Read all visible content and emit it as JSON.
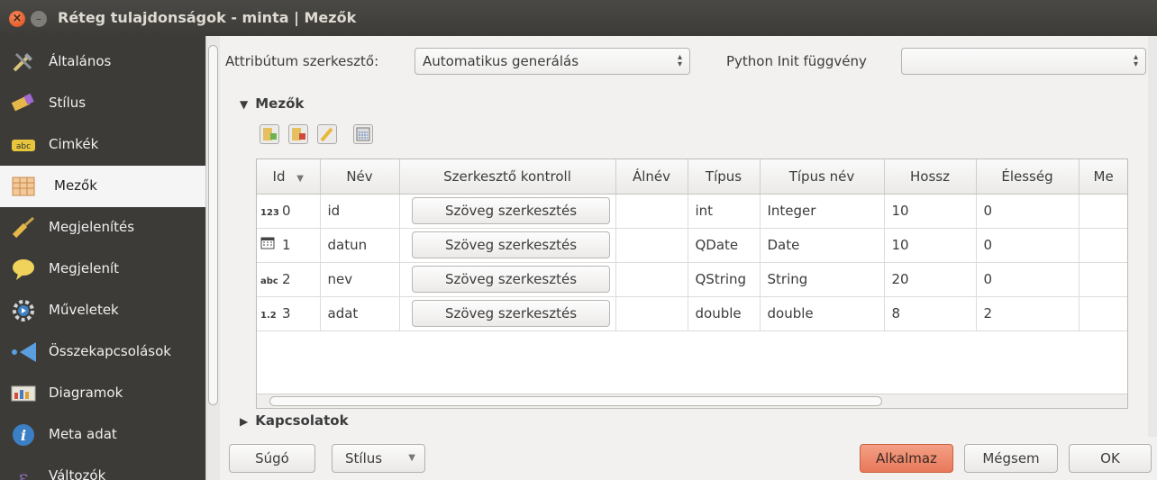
{
  "window": {
    "title": "Réteg tulajdonságok - minta | Mezők"
  },
  "sidebar": {
    "items": [
      {
        "label": "Általános",
        "icon": "tools-icon"
      },
      {
        "label": "Stílus",
        "icon": "brush-icon"
      },
      {
        "label": "Cimkék",
        "icon": "label-abc-icon"
      },
      {
        "label": "Mezők",
        "icon": "table-icon"
      },
      {
        "label": "Megjelenítés",
        "icon": "paint-brush-icon"
      },
      {
        "label": "Megjelenít",
        "icon": "speech-bubble-icon"
      },
      {
        "label": "Műveletek",
        "icon": "gear-icon"
      },
      {
        "label": "Összekapcsolások",
        "icon": "join-arrow-icon"
      },
      {
        "label": "Diagramok",
        "icon": "diagram-icon"
      },
      {
        "label": "Meta adat",
        "icon": "info-icon"
      },
      {
        "label": "Változók",
        "icon": "variable-icon"
      }
    ],
    "active": "Mezők"
  },
  "form": {
    "attr_editor_label": "Attribútum szerkesztő:",
    "attr_editor_value": "Automatikus generálás",
    "python_init_label": "Python Init függvény",
    "python_init_value": ""
  },
  "fields_section": {
    "title": "Mezők",
    "expanded": true
  },
  "relations_section": {
    "title": "Kapcsolatok",
    "expanded": false
  },
  "table": {
    "headers": [
      "Id",
      "Név",
      "Szerkesztő kontroll",
      "Álnév",
      "Típus",
      "Típus név",
      "Hossz",
      "Élesség",
      "Me"
    ],
    "rows": [
      {
        "type_icon": "123",
        "id": "0",
        "name": "id",
        "editor": "Szöveg szerkesztés",
        "alias": "",
        "type": "int",
        "type_name": "Integer",
        "length": "10",
        "precision": "0"
      },
      {
        "type_icon": "date-icon",
        "id": "1",
        "name": "datun",
        "editor": "Szöveg szerkesztés",
        "alias": "",
        "type": "QDate",
        "type_name": "Date",
        "length": "10",
        "precision": "0"
      },
      {
        "type_icon": "abc",
        "id": "2",
        "name": "nev",
        "editor": "Szöveg szerkesztés",
        "alias": "",
        "type": "QString",
        "type_name": "String",
        "length": "20",
        "precision": "0"
      },
      {
        "type_icon": "1.2",
        "id": "3",
        "name": "adat",
        "editor": "Szöveg szerkesztés",
        "alias": "",
        "type": "double",
        "type_name": "double",
        "length": "8",
        "precision": "2"
      }
    ]
  },
  "buttons": {
    "help": "Súgó",
    "style": "Stílus",
    "apply": "Alkalmaz",
    "cancel": "Mégsem",
    "ok": "OK"
  },
  "colors": {
    "sidebar_bg": "#3c3b37",
    "apply_accent": "#e8785a",
    "titlebar": "#3c3b37"
  }
}
